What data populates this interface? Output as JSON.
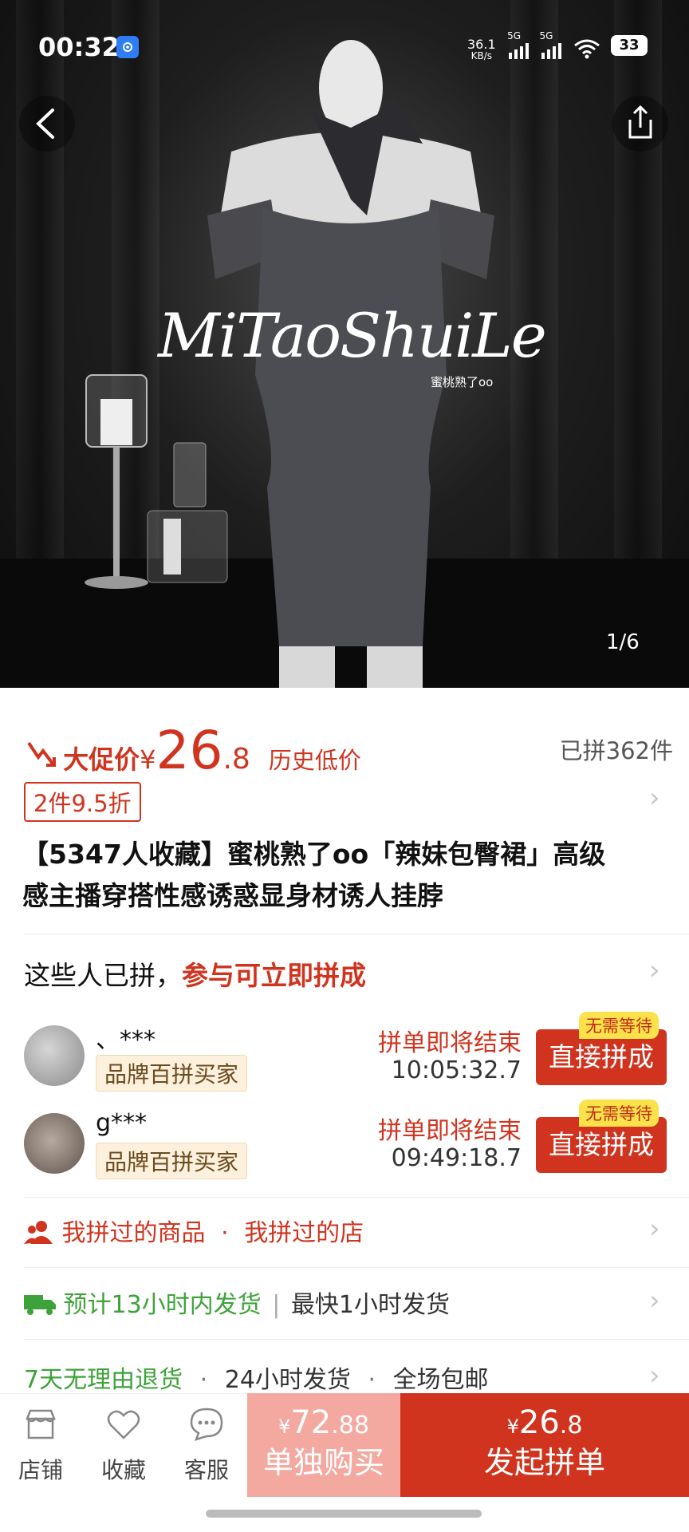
{
  "status_bar": {
    "time": "00:32",
    "net_speed_1": "36.1",
    "net_speed_2": "KB/s",
    "sig1": "5G",
    "sig2": "5G",
    "battery": "33"
  },
  "hero": {
    "brand": "MiTaoShuiLe",
    "brand_sub": "蜜桃熟了oo",
    "counter": "1/6"
  },
  "price": {
    "promo_label": "大促价",
    "currency": "¥",
    "integer": "26",
    "decimal": ".8",
    "history_note": "历史低价",
    "sold": "已拼362件",
    "discount_tag": "2件9.5折"
  },
  "product": {
    "title_line1": "【5347人收藏】蜜桃熟了oo「辣妹包臀裙」高级",
    "title_line2": "感主播穿搭性感诱惑显身材诱人挂脖"
  },
  "group": {
    "head_plain": "这些人已拼，",
    "head_emph": "参与可立即拼成",
    "orders": [
      {
        "user": "、***",
        "tag": "品牌百拼买家",
        "ending": "拼单即将结束",
        "countdown": "10:05:32.7",
        "badge": "无需等待",
        "button": "直接拼成"
      },
      {
        "user": "g***",
        "tag": "品牌百拼买家",
        "ending": "拼单即将结束",
        "countdown": "09:49:18.7",
        "badge": "无需等待",
        "button": "直接拼成"
      }
    ]
  },
  "history_row": {
    "text1": "我拼过的商品",
    "sep": "·",
    "text2": "我拼过的店"
  },
  "shipping_row": {
    "green": "预计13小时内发货",
    "sep": "|",
    "grey": "最快1小时发货"
  },
  "services_row": {
    "green": "7天无理由退货",
    "item2": "24小时发货",
    "item3": "全场包邮",
    "sep": "·"
  },
  "bottom_bar": {
    "shop": "店铺",
    "fav": "收藏",
    "service": "客服",
    "solo": {
      "currency": "¥",
      "integer": "72",
      "decimal": ".88",
      "label": "单独购买"
    },
    "group": {
      "currency": "¥",
      "integer": "26",
      "decimal": ".8",
      "label": "发起拼单"
    }
  },
  "colors": {
    "accent": "#d0341f",
    "green": "#3ea23a",
    "solo_button": "#f3a8a0"
  }
}
